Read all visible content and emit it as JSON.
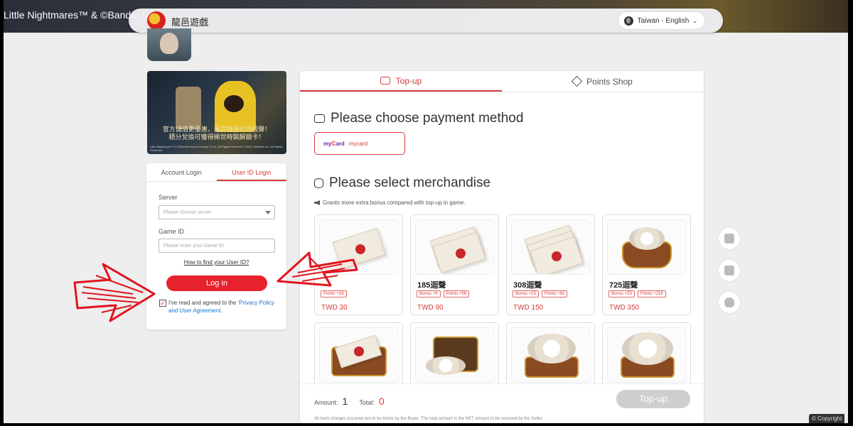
{
  "banner": {
    "text": "Little Nightmares™ & ©Bandai N"
  },
  "navbar": {
    "brand": "龍邑遊戲",
    "language": "Taiwan - English"
  },
  "promo": {
    "caption_line1": "官方儲值更優惠，最高贈送659迴聲！",
    "caption_line2": "積分兌換可獲得稀世時裝解鎖卡！",
    "fine_print": "Little Nightmares™ & ©Bandai Namco Europe S.A.S. All Rights Reserved. ©2024 NetEase Inc. All Rights Reserved."
  },
  "login": {
    "tabs": [
      "Account Login",
      "User ID Login"
    ],
    "server_label": "Server",
    "server_placeholder": "Please choose server",
    "gameid_label": "Game ID",
    "gameid_placeholder": "Please enter your Game ID",
    "howto": "How to find your User ID?",
    "login_button": "Log in",
    "agree_text": "I've read and agreed to the ",
    "agree_link": "'Privacy Policy and User Agreement."
  },
  "main": {
    "tabs": [
      "Top-up",
      "Points Shop"
    ],
    "payment_title": "Please choose payment method",
    "payment_option": "mycard",
    "merch_title": "Please select merchandise",
    "note": "Grants more extra bonus compared with top-up in game.",
    "items": [
      {
        "name": "",
        "badges": [
          "Points +18"
        ],
        "price": "TWD 30"
      },
      {
        "name": "185迴聲",
        "badges": [
          "Bonus +9",
          "Points +56"
        ],
        "price": "TWD 90"
      },
      {
        "name": "308迴聲",
        "badges": [
          "Bonus +15",
          "Points +92"
        ],
        "price": "TWD 150"
      },
      {
        "name": "725迴聲",
        "badges": [
          "Bonus +33",
          "Points +218"
        ],
        "price": "TWD 350"
      },
      {
        "name": "",
        "badges": [],
        "price": ""
      },
      {
        "name": "",
        "badges": [],
        "price": ""
      },
      {
        "name": "",
        "badges": [],
        "price": ""
      },
      {
        "name": "",
        "badges": [],
        "price": ""
      }
    ],
    "amount_label": "Amount:",
    "amount_value": "1",
    "total_label": "Total:",
    "total_value": "0",
    "topup_button": "Top-up",
    "disclaimer": "All bank charges occurred are to be borne by the Buyer. The total amount is the NET amount to be received by the Seller."
  },
  "copyright": "© Copyright",
  "colors": {
    "accent": "#d83b3b",
    "button_red": "#e8222c",
    "link": "#1a73c8"
  }
}
